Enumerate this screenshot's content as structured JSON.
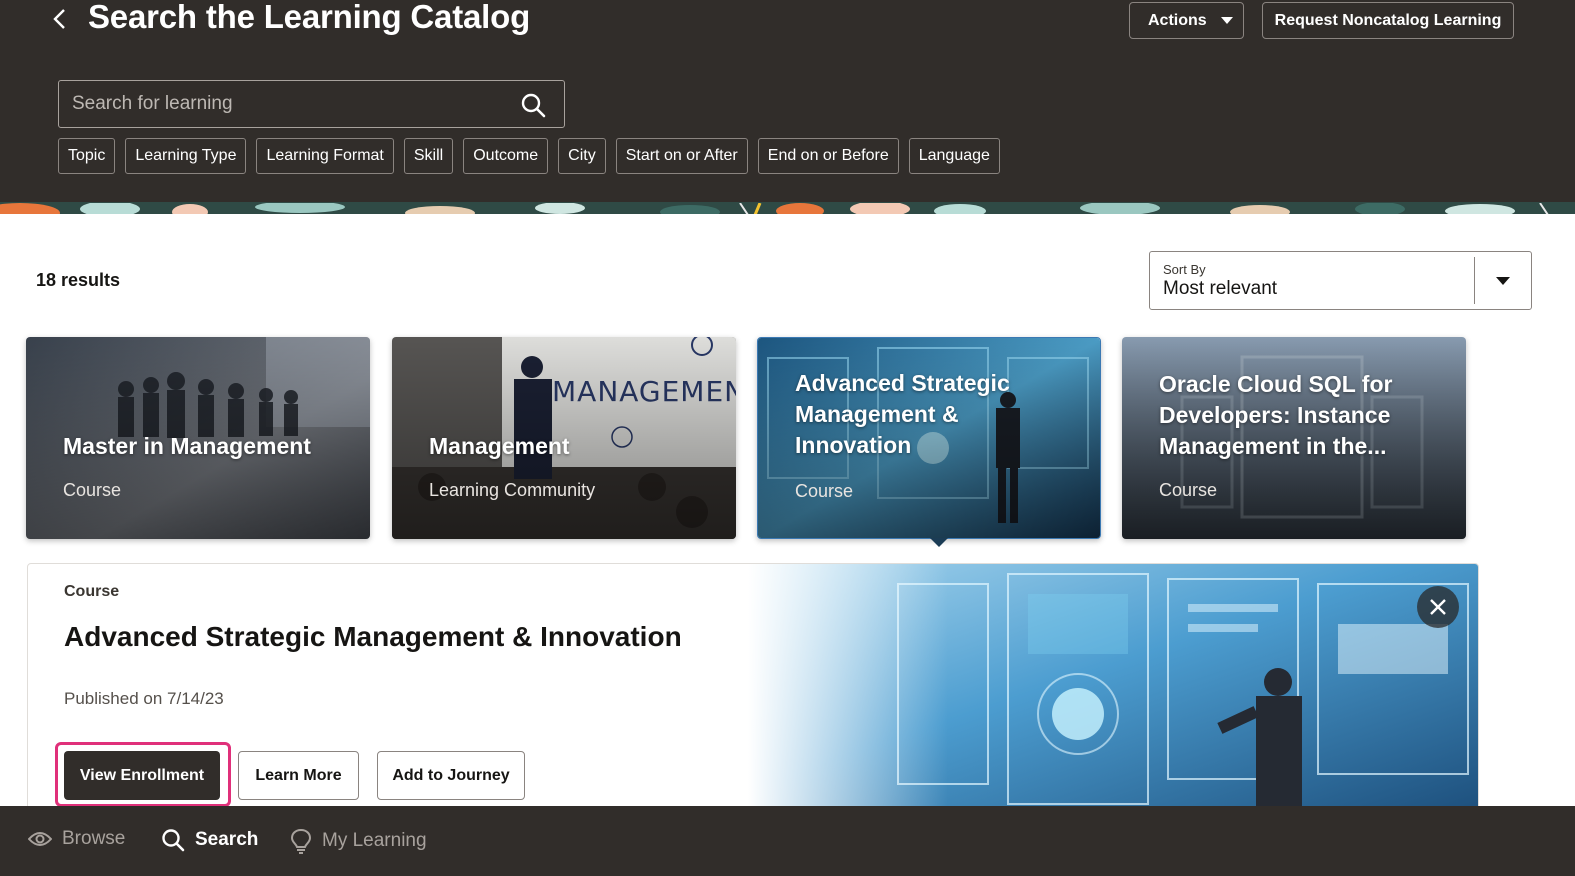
{
  "header": {
    "title": "Search the Learning Catalog",
    "actions_label": "Actions",
    "request_label": "Request Noncatalog Learning"
  },
  "search": {
    "placeholder": "Search for learning",
    "value": ""
  },
  "filters": [
    "Topic",
    "Learning Type",
    "Learning Format",
    "Skill",
    "Outcome",
    "City",
    "Start on or After",
    "End on or Before",
    "Language"
  ],
  "results": {
    "count_label": "18 results"
  },
  "sort": {
    "label": "Sort By",
    "value": "Most relevant"
  },
  "cards": [
    {
      "title": "Master in Management",
      "type": "Course"
    },
    {
      "title": "Management",
      "type": "Learning Community"
    },
    {
      "title": "Advanced Strategic Management & Innovation",
      "type": "Course"
    },
    {
      "title": "Oracle Cloud SQL for Developers: Instance Management in the...",
      "type": "Course"
    }
  ],
  "detail": {
    "type": "Course",
    "title": "Advanced Strategic Management & Innovation",
    "published": "Published on 7/14/23",
    "primary_label": "View Enrollment",
    "learn_more_label": "Learn More",
    "journey_label": "Add to Journey"
  },
  "bottom_nav": {
    "browse": "Browse",
    "search": "Search",
    "my_learning": "My Learning"
  },
  "colors": {
    "header_bg": "#312d2a",
    "highlight": "#e0307a",
    "primary_button": "#312d2a"
  }
}
